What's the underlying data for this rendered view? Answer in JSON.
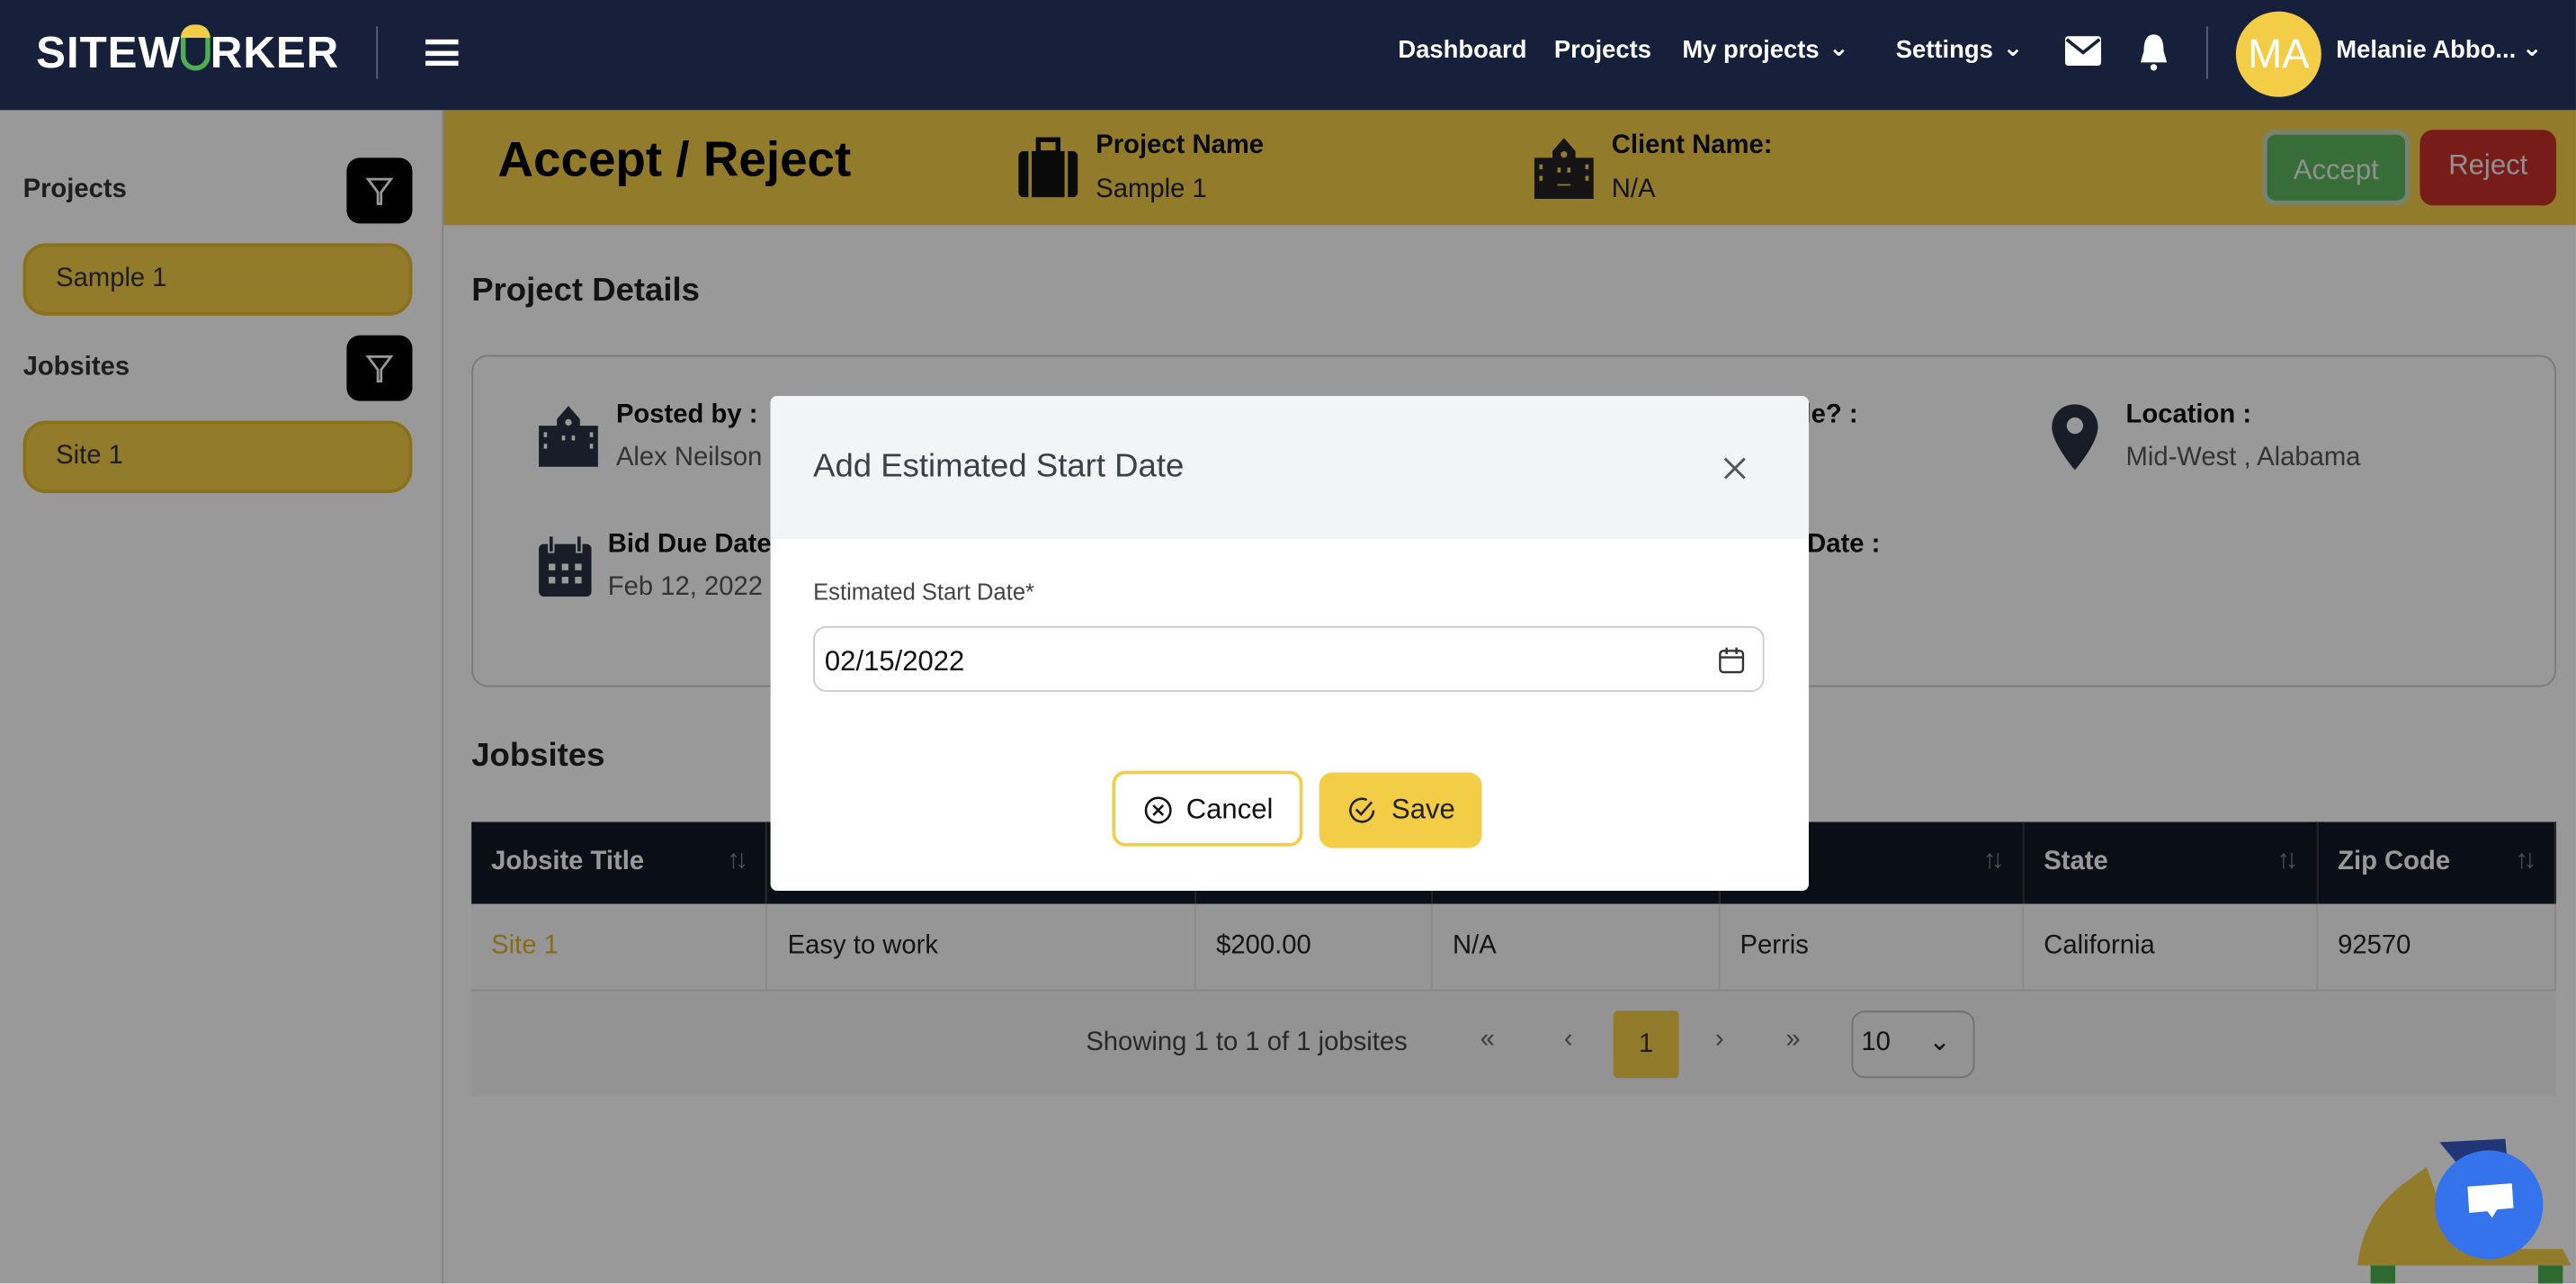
{
  "navbar": {
    "logo": "SITEWORKER",
    "items": [
      "Dashboard",
      "Projects",
      "My projects",
      "Settings"
    ],
    "avatar_initials": "MA",
    "user_name": "Melanie Abbo...",
    "icons": [
      "menu-icon",
      "mail-icon",
      "bell-icon",
      "chevron-down-icon"
    ]
  },
  "sidebar": {
    "projects_label": "Projects",
    "projects": [
      "Sample 1"
    ],
    "jobsites_label": "Jobsites",
    "jobsites": [
      "Site 1"
    ]
  },
  "header": {
    "title": "Accept / Reject",
    "project_name_label": "Project Name",
    "project_name": "Sample 1",
    "client_name_label": "Client Name:",
    "client_name": "N/A",
    "accept": "Accept",
    "reject": "Reject"
  },
  "details": {
    "title": "Project Details",
    "posted_by_label": "Posted by :",
    "posted_by": "Alex Neilson",
    "bid_due_label": "Bid Due Date",
    "bid_due": "Feb 12, 2022",
    "partial_label_1": "le? :",
    "partial_label_2": "Date :",
    "location_label": "Location :",
    "location": "Mid-West , Alabama"
  },
  "jobsites": {
    "title": "Jobsites",
    "columns": [
      "Jobsite Title",
      "",
      "",
      "",
      "",
      "State",
      "Zip Code"
    ],
    "rows": [
      [
        "Site 1",
        "Easy to work",
        "$200.00",
        "N/A",
        "Perris",
        "California",
        "92570"
      ]
    ],
    "showing": "Showing 1 to 1 of 1 jobsites",
    "page": "1",
    "page_size": "10"
  },
  "modal": {
    "title": "Add Estimated Start Date",
    "field_label": "Estimated Start Date*",
    "field_value": "02/15/2022",
    "cancel": "Cancel",
    "save": "Save"
  },
  "colors": {
    "brand_yellow": "#f4cd46",
    "navbar": "#16203a",
    "accept": "#5cb85c",
    "reject": "#c9302c",
    "chat": "#3573ec"
  }
}
